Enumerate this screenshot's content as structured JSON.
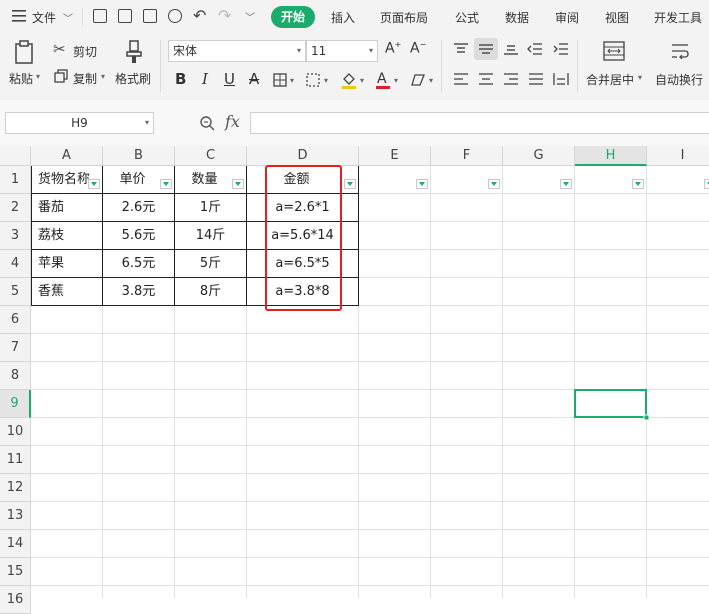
{
  "menubar": {
    "file_label": "文件",
    "tabs": [
      {
        "label": "开始",
        "active": true
      },
      {
        "label": "插入"
      },
      {
        "label": "页面布局"
      },
      {
        "label": "公式"
      },
      {
        "label": "数据"
      },
      {
        "label": "审阅"
      },
      {
        "label": "视图"
      },
      {
        "label": "开发工具"
      }
    ]
  },
  "ribbon": {
    "paste_label": "粘贴",
    "cut_label": "剪切",
    "copy_label": "复制",
    "format_painter_label": "格式刷",
    "font_name": "宋体",
    "font_size": "11",
    "merge_center_label": "合并居中",
    "wrap_text_label": "自动换行",
    "accent_color": "#1bab6b",
    "font_color_bar": "#d8241e"
  },
  "formula_bar": {
    "name_box": "H9",
    "fx_label": "fx",
    "formula": ""
  },
  "sheet": {
    "columns": [
      "A",
      "B",
      "C",
      "D",
      "E",
      "F",
      "G",
      "H",
      "I"
    ],
    "selected_column": "H",
    "rows": [
      "1",
      "2",
      "3",
      "4",
      "5",
      "6",
      "7",
      "8",
      "9",
      "10",
      "11",
      "12",
      "13",
      "14",
      "15",
      "16"
    ],
    "selected_row": "9",
    "header": [
      "货物名称",
      "单价",
      "数量",
      "金额"
    ],
    "data": [
      [
        "番茄",
        "2.6元",
        "1斤",
        "a=2.6*1"
      ],
      [
        "荔枝",
        "5.6元",
        "14斤",
        "a=5.6*14"
      ],
      [
        "苹果",
        "6.5元",
        "5斤",
        "a=6.5*5"
      ],
      [
        "香蕉",
        "3.8元",
        "8斤",
        "a=3.8*8"
      ]
    ],
    "highlight_color": "#e02020",
    "selection_color": "#1bab6b"
  }
}
